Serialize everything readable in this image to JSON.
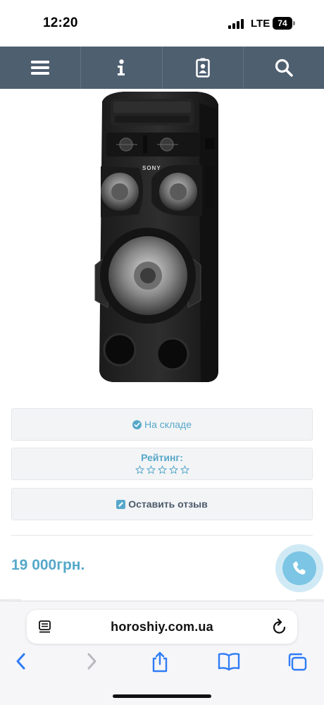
{
  "status_bar": {
    "time": "12:20",
    "network": "LTE",
    "battery": "74"
  },
  "navbar": {
    "items": [
      {
        "icon": "menu-icon"
      },
      {
        "icon": "info-icon"
      },
      {
        "icon": "contact-card-icon"
      },
      {
        "icon": "search-icon"
      }
    ],
    "background": "#4e5f70"
  },
  "product": {
    "brand_logo": "SONY",
    "stock_status": "На складе",
    "rating_label": "Рейтинг:",
    "rating_stars": 0,
    "rating_max": 5,
    "review_button": "Оставить отзыв",
    "price": "19 000грн."
  },
  "browser": {
    "url": "horoshiy.com.ua"
  },
  "colors": {
    "accent": "#56a8c9",
    "text_dark": "#4a5a6a"
  }
}
